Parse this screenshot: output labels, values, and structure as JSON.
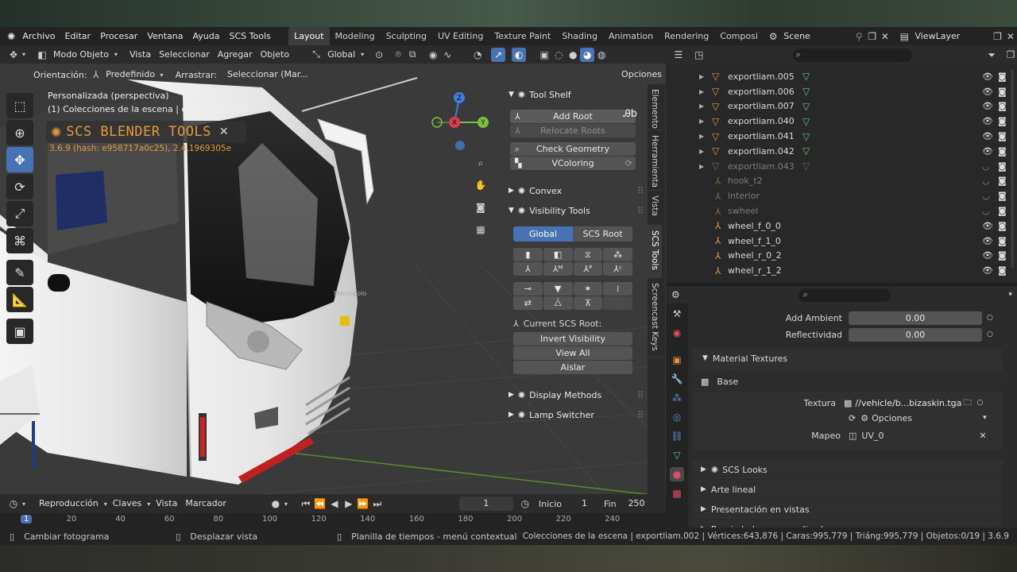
{
  "menu": {
    "items": [
      "Archivo",
      "Editar",
      "Procesar",
      "Ventana",
      "Ayuda",
      "SCS Tools"
    ],
    "workspaces": [
      "Layout",
      "Modeling",
      "Sculpting",
      "UV Editing",
      "Texture Paint",
      "Shading",
      "Animation",
      "Rendering",
      "Composi"
    ],
    "active_workspace": "Layout",
    "scene_label": "Scene",
    "viewlayer_label": "ViewLayer"
  },
  "viewport_header": {
    "mode": "Modo Objeto",
    "menus": [
      "Vista",
      "Seleccionar",
      "Agregar",
      "Objeto"
    ],
    "transform": "Global"
  },
  "tool_settings": {
    "orientation_label": "Orientación:",
    "orientation_value": "Predefinido",
    "drag_label": "Arrastrar:",
    "drag_value": "Seleccionar (Mar...",
    "options": "Opciones"
  },
  "viewport": {
    "view_name": "Personalizada (perspectiva)",
    "collection_info": "(1) Colecciones de la escena | exportliam.002",
    "addon_title": "SCS BLENDER TOOLS",
    "version_text": "3.6.9 (hash: e958717a0c25), 2.4.1969305e",
    "bus_brand": "Marcopolo",
    "gizmo": {
      "z": "Z",
      "y": "Y",
      "x": "X"
    }
  },
  "npanel": {
    "tool_shelf": "Tool Shelf",
    "add_root": "Add Root",
    "relocate_roots": "Relocate Roots",
    "check_geometry": "Check Geometry",
    "vcoloring": "VColoring",
    "convex": "Convex",
    "visibility_tools": "Visibility Tools",
    "global_tab": "Global",
    "scs_root_tab": "SCS Root",
    "current_root": "Current SCS Root:",
    "invert_visibility": "Invert Visibility",
    "view_all": "View All",
    "isolate": "Aislar",
    "display_methods": "Display Methods",
    "lamp_switcher": "Lamp Switcher",
    "vertical_tabs": [
      "Elemento",
      "Herramienta",
      "Vista",
      "SCS Tools",
      "Screencast Keys"
    ]
  },
  "outliner": {
    "rows": [
      {
        "name": "exportliam.005",
        "type": "empty",
        "dim": false
      },
      {
        "name": "exportliam.006",
        "type": "empty",
        "dim": false
      },
      {
        "name": "exportliam.007",
        "type": "empty",
        "dim": false
      },
      {
        "name": "exportliam.040",
        "type": "empty",
        "dim": false
      },
      {
        "name": "exportliam.041",
        "type": "empty",
        "dim": false
      },
      {
        "name": "exportliam.042",
        "type": "empty",
        "dim": false
      },
      {
        "name": "exportliam.043",
        "type": "empty",
        "dim": true
      },
      {
        "name": "hook_t2",
        "type": "locator",
        "dim": true
      },
      {
        "name": "interior",
        "type": "locator",
        "dim": true
      },
      {
        "name": "swheel",
        "type": "locator",
        "dim": true
      },
      {
        "name": "wheel_f_0_0",
        "type": "locator",
        "dim": false
      },
      {
        "name": "wheel_f_1_0",
        "type": "locator",
        "dim": false
      },
      {
        "name": "wheel_r_0_2",
        "type": "locator",
        "dim": false
      },
      {
        "name": "wheel_r_1_2",
        "type": "locator",
        "dim": false
      }
    ]
  },
  "properties": {
    "add_ambient_label": "Add Ambient",
    "add_ambient_value": "0.00",
    "reflectivity_label": "Reflectividad",
    "reflectivity_value": "0.00",
    "material_textures": "Material Textures",
    "base": "Base",
    "texture_label": "Textura",
    "texture_value": "//vehicle/b...bizaskin.tga",
    "options": "Opciones",
    "mapping_label": "Mapeo",
    "mapping_value": "UV_0",
    "sections": [
      "SCS Looks",
      "Arte lineal",
      "Presentación en vistas",
      "Propiedades personalizadas"
    ]
  },
  "timeline": {
    "menus": [
      "Reproducción",
      "Claves",
      "Vista",
      "Marcador"
    ],
    "current_frame": "1",
    "start_label": "Inicio",
    "start_value": "1",
    "end_label": "Fin",
    "end_value": "250",
    "ruler": [
      "1",
      "20",
      "40",
      "60",
      "80",
      "100",
      "120",
      "140",
      "160",
      "180",
      "200",
      "220",
      "240"
    ]
  },
  "statusbar": {
    "left1": "Cambiar fotograma",
    "left2": "Desplazar vista",
    "left3": "Planilla de tiempos - menú contextual",
    "stats": "Colecciones de la escena | exportliam.002 | Vértices:643,876 | Caras:995,779 | Triáng:995,779 | Objetos:0/19 | 3.6.9"
  },
  "colors": {
    "accent": "#4772b3",
    "orange": "#e59a3a",
    "green": "#5fc77a"
  }
}
